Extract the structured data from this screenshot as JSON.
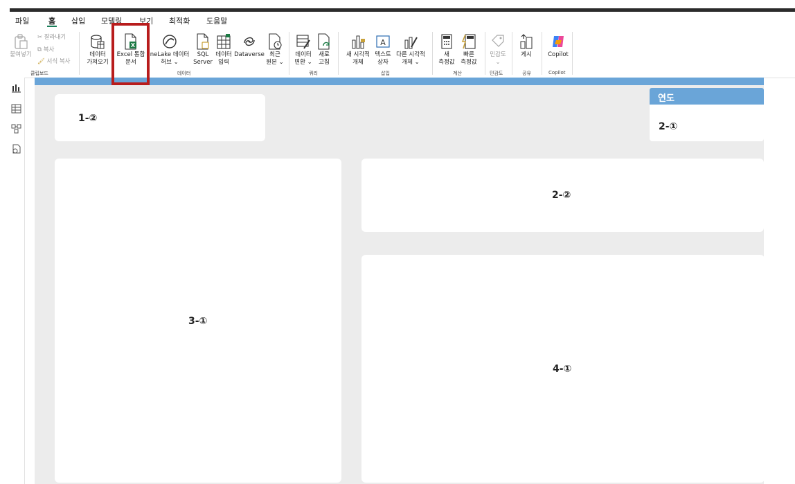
{
  "menu": {
    "items": [
      "파일",
      "홈",
      "삽입",
      "모델링",
      "보기",
      "최적화",
      "도움말"
    ],
    "active": "홈"
  },
  "ribbon": {
    "clipboard": {
      "paste": "붙여넣기",
      "cut": "잘라내기",
      "copy": "복사",
      "format_painter": "서식 복사",
      "label": "클립보드"
    },
    "data": {
      "get_data": [
        "데이터",
        "가져오기"
      ],
      "excel": [
        "Excel 통합",
        "문서"
      ],
      "onelake": [
        "neLake 데이터",
        "허브 ⌄"
      ],
      "sql": [
        "SQL",
        "Server"
      ],
      "enter_data": [
        "데이터",
        "입력"
      ],
      "dataverse": "Dataverse",
      "recent": [
        "최근",
        "원본 ⌄"
      ],
      "label": "데이터"
    },
    "query": {
      "transform": [
        "데이터",
        "변환 ⌄"
      ],
      "refresh": [
        "새로",
        "고침"
      ],
      "label": "쿼리"
    },
    "insert": {
      "new_visual": [
        "새 시각적",
        "개체"
      ],
      "text_box": [
        "텍스트",
        "상자"
      ],
      "more_visuals": [
        "다른 시각적",
        "개체 ⌄"
      ],
      "label": "삽입"
    },
    "calc": {
      "new_measure": [
        "새",
        "측정값"
      ],
      "quick_measure": [
        "빠른",
        "측정값"
      ],
      "label": "계산"
    },
    "sensitivity": {
      "button": [
        "민감도",
        "⌄"
      ],
      "label": "민감도"
    },
    "share": {
      "publish": "게시",
      "label": "공유"
    },
    "copilot": {
      "button": "Copilot",
      "label": "Copilot"
    }
  },
  "canvas": {
    "cards": {
      "c1_2": "1-②",
      "c2_1": "2-①",
      "c2_2": "2-②",
      "c3_1": "3-①",
      "c4_1": "4-①"
    },
    "slicer_header": "연도"
  },
  "colors": {
    "accent_band": "#6aa5d8",
    "highlight": "#b81c1c",
    "canvas_bg": "#ececec"
  }
}
